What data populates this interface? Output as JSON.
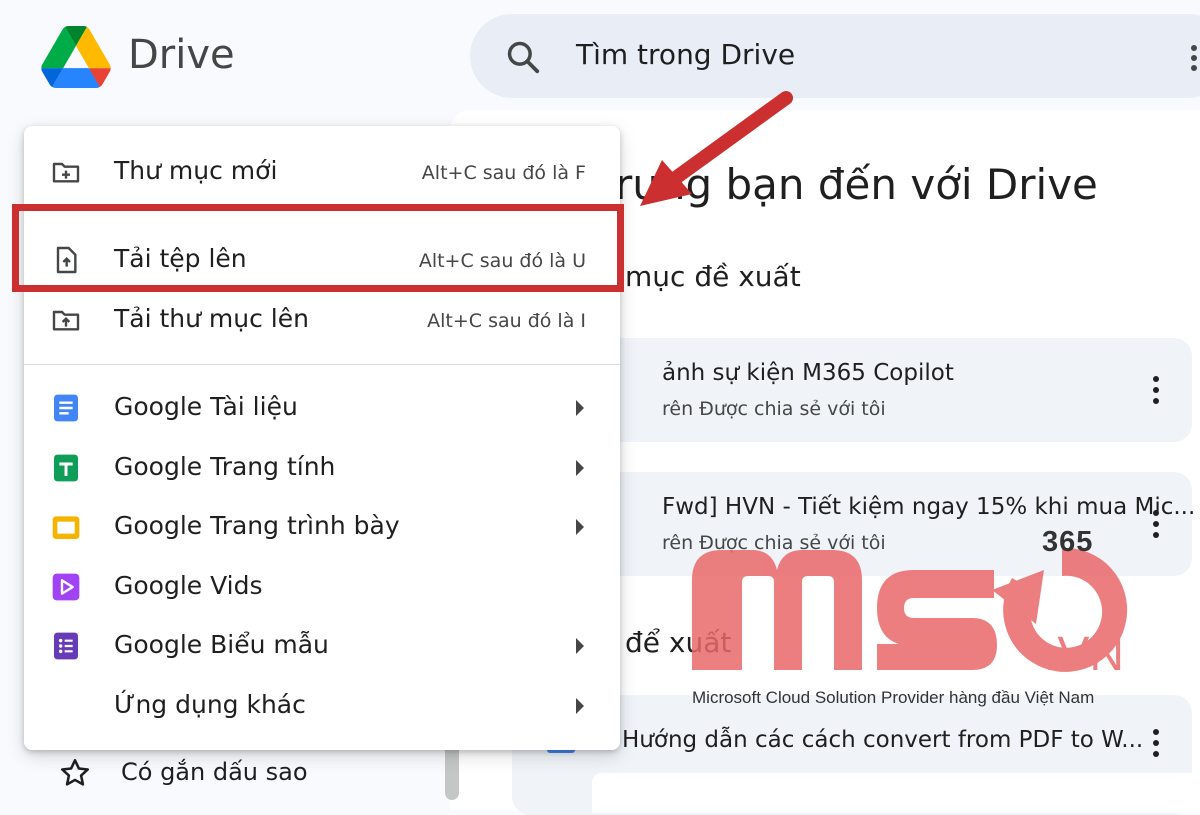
{
  "app": {
    "brand": "Drive",
    "search_placeholder": "Tìm trong Drive"
  },
  "main": {
    "welcome_text": "rung bạn đến với Drive",
    "section_suggested_folders": "mục đề xuất",
    "section_suggested_files": "để xuất",
    "cards": [
      {
        "title": "ảnh sự kiện M365 Copilot",
        "subtitle": "rên Được chia sẻ với tôi"
      },
      {
        "title": "Fwd] HVN - Tiết kiệm ngay 15% khi mua Mic...",
        "subtitle": "rên Được chia sẻ với tôi"
      }
    ],
    "file_row_title": "Hướng dẫn các cách convert from PDF to W..."
  },
  "sidebar": {
    "starred_label": "Có gắn dấu sao"
  },
  "menu": {
    "items": [
      {
        "label": "Thư mục mới",
        "shortcut": "Alt+C sau đó là F",
        "icon": "new-folder-icon"
      },
      {
        "label": "Tải tệp lên",
        "shortcut": "Alt+C sau đó là U",
        "icon": "file-upload-icon"
      },
      {
        "label": "Tải thư mục lên",
        "shortcut": "Alt+C sau đó là I",
        "icon": "folder-upload-icon"
      },
      {
        "label": "Google Tài liệu",
        "icon": "google-docs-icon",
        "color": "#4285f4"
      },
      {
        "label": "Google Trang tính",
        "icon": "google-sheets-icon",
        "color": "#0f9d58"
      },
      {
        "label": "Google Trang trình bày",
        "icon": "google-slides-icon",
        "color": "#f4b400"
      },
      {
        "label": "Google Vids",
        "icon": "google-vids-icon",
        "color": "#a142f4"
      },
      {
        "label": "Google Biểu mẫu",
        "icon": "google-forms-icon",
        "color": "#673ab7"
      },
      {
        "label": "Ứng dụng khác"
      }
    ]
  },
  "watermark": {
    "badge": "365",
    "tagline": "Microsoft Cloud Solution Provider hàng đầu Việt Nam"
  },
  "colors": {
    "highlight": "#cc2f2f",
    "watermark": "#e9686a"
  }
}
